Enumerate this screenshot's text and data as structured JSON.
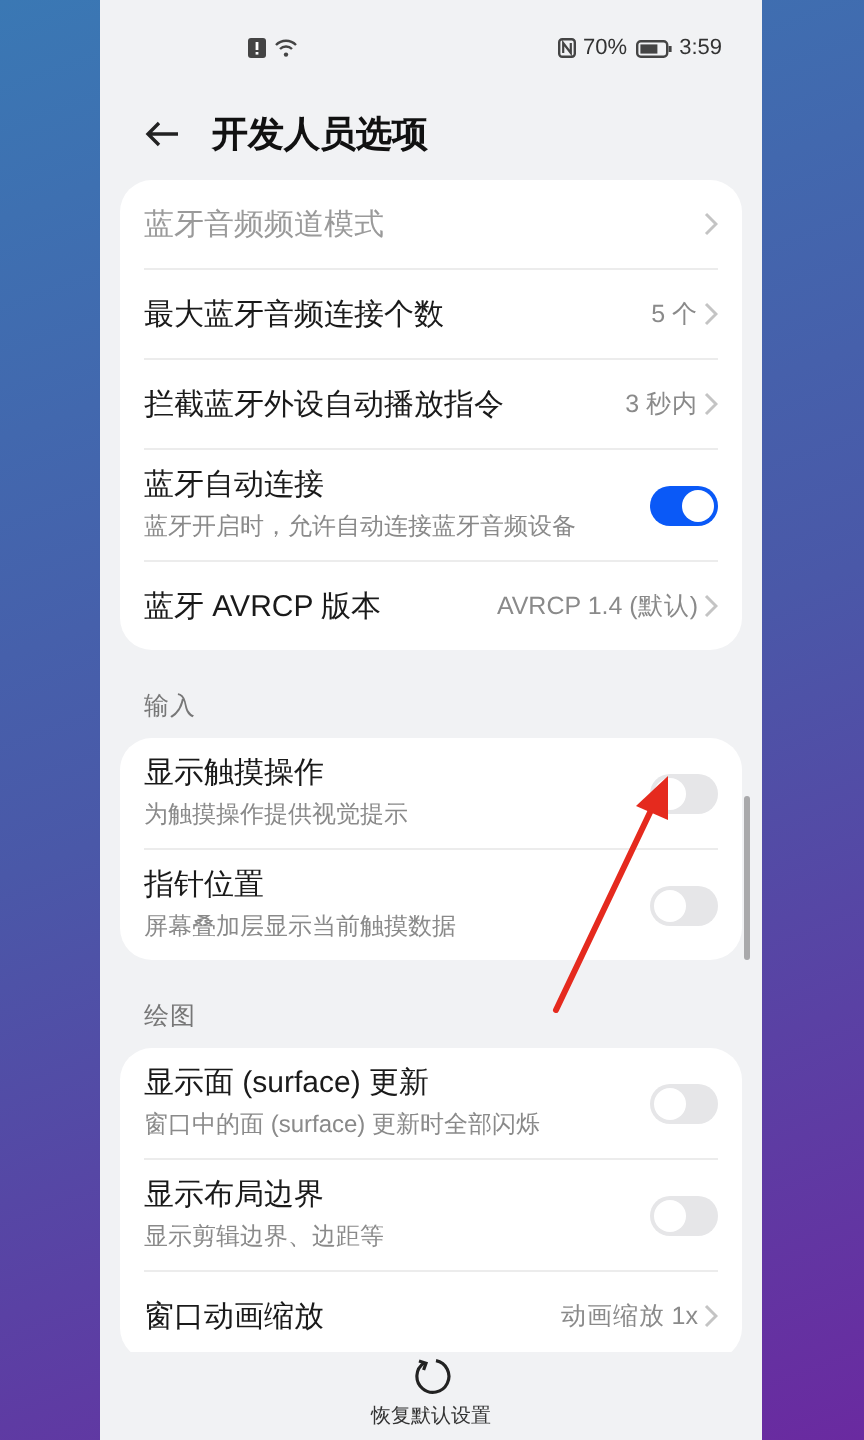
{
  "status_bar": {
    "battery": "70%",
    "time": "3:59"
  },
  "header": {
    "title": "开发人员选项"
  },
  "sections": [
    {
      "rows": [
        {
          "kind": "link",
          "title": "蓝牙音频频道模式",
          "disabled": true
        },
        {
          "kind": "link",
          "title": "最大蓝牙音频连接个数",
          "value": "5 个",
          "disabled": false
        },
        {
          "kind": "link",
          "title": "拦截蓝牙外设自动播放指令",
          "value": "3 秒内",
          "disabled": false
        },
        {
          "kind": "toggle",
          "title": "蓝牙自动连接",
          "subtitle": "蓝牙开启时，允许自动连接蓝牙音频设备",
          "checked": true
        },
        {
          "kind": "link",
          "title": "蓝牙 AVRCP 版本",
          "value": "AVRCP 1.4 (默认)",
          "disabled": false
        }
      ]
    },
    {
      "header": "输入",
      "rows": [
        {
          "kind": "toggle",
          "title": "显示触摸操作",
          "subtitle": "为触摸操作提供视觉提示",
          "checked": false
        },
        {
          "kind": "toggle",
          "title": "指针位置",
          "subtitle": "屏幕叠加层显示当前触摸数据",
          "checked": false
        }
      ]
    },
    {
      "header": "绘图",
      "rows": [
        {
          "kind": "toggle",
          "title": "显示面 (surface) 更新",
          "subtitle": "窗口中的面 (surface) 更新时全部闪烁",
          "checked": false
        },
        {
          "kind": "toggle",
          "title": "显示布局边界",
          "subtitle": "显示剪辑边界、边距等",
          "checked": false
        },
        {
          "kind": "link",
          "title": "窗口动画缩放",
          "value": "动画缩放 1x",
          "disabled": false
        }
      ]
    }
  ],
  "footer": {
    "label": "恢复默认设置"
  }
}
